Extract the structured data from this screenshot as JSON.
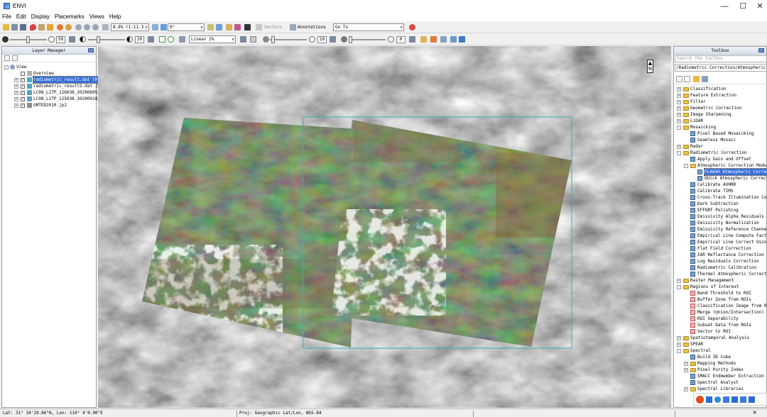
{
  "window": {
    "title": "ENVI",
    "minimize": "—",
    "maximize": "☐",
    "close": "✕"
  },
  "menu": [
    "File",
    "Edit",
    "Display",
    "Placemarks",
    "Views",
    "Help"
  ],
  "toolbar1": {
    "zoom_value": "8.8% (1:11.3",
    "rotation_value": "0°",
    "vectors_label": "Vectors",
    "annotations_label": "Annotations",
    "goto_value": "Go To"
  },
  "toolbar2": {
    "brightness_value": "50",
    "contrast_value": "20",
    "stretch_value": "Linear 2%",
    "sharpen_value": "10",
    "transparency_value": "0"
  },
  "layer_manager": {
    "title": "Layer Manager",
    "root": "View",
    "items": [
      {
        "label": "Overview",
        "checked": false,
        "selected": false
      },
      {
        "label": "radiometric_result.dat [R",
        "checked": true,
        "selected": true
      },
      {
        "label": "radiometric_result2.dat [R",
        "checked": true,
        "selected": false
      },
      {
        "label": "LC08_L1TP_126038_20200605_",
        "checked": true,
        "selected": false
      },
      {
        "label": "LC08_L1TP_125038_20200918_",
        "checked": true,
        "selected": false
      },
      {
        "label": "GMTED2010.jp2",
        "checked": true,
        "selected": false
      }
    ]
  },
  "map": {
    "north_label": "N",
    "north_icon": "north-arrow-icon"
  },
  "toolbox": {
    "title": "Toolbox",
    "search_placeholder": "Search the toolbox",
    "path": "/Radiometric Correction/Atmospheric Co",
    "items": [
      {
        "label": "Classification",
        "level": 0,
        "kind": "folder",
        "exp": "+"
      },
      {
        "label": "Feature Extraction",
        "level": 0,
        "kind": "folder",
        "exp": "+"
      },
      {
        "label": "Filter",
        "level": 0,
        "kind": "folder",
        "exp": "+"
      },
      {
        "label": "Geometric Correction",
        "level": 0,
        "kind": "folder",
        "exp": "+"
      },
      {
        "label": "Image Sharpening",
        "level": 0,
        "kind": "folder",
        "exp": "+"
      },
      {
        "label": "LiDAR",
        "level": 0,
        "kind": "folder",
        "exp": "+"
      },
      {
        "label": "Mosaicking",
        "level": 0,
        "kind": "folder",
        "exp": "-"
      },
      {
        "label": "Pixel Based Mosaicking",
        "level": 1,
        "kind": "tool"
      },
      {
        "label": "Seamless Mosaic",
        "level": 1,
        "kind": "tool"
      },
      {
        "label": "Radar",
        "level": 0,
        "kind": "folder",
        "exp": "+"
      },
      {
        "label": "Radiometric Correction",
        "level": 0,
        "kind": "folder",
        "exp": "-"
      },
      {
        "label": "Apply Gain and Offset",
        "level": 1,
        "kind": "tool"
      },
      {
        "label": "Atmospheric Correction Modul",
        "level": 1,
        "kind": "folder",
        "exp": "-"
      },
      {
        "label": "FLAASH Atmospheric Correc",
        "level": 2,
        "kind": "tool",
        "selected": true
      },
      {
        "label": "QUick Atmospheric Correct",
        "level": 2,
        "kind": "tool"
      },
      {
        "label": "Calibrate AVHRR",
        "level": 1,
        "kind": "tool"
      },
      {
        "label": "Calibrate TIMS",
        "level": 1,
        "kind": "tool"
      },
      {
        "label": "Cross-Track Illumination Cor",
        "level": 1,
        "kind": "tool"
      },
      {
        "label": "Dark Subtraction",
        "level": 1,
        "kind": "tool"
      },
      {
        "label": "EFFORT Polishing",
        "level": 1,
        "kind": "tool"
      },
      {
        "label": "Emissivity Alpha Residuals",
        "level": 1,
        "kind": "tool"
      },
      {
        "label": "Emissivity Normalization",
        "level": 1,
        "kind": "tool"
      },
      {
        "label": "Emissivity Reference Channel",
        "level": 1,
        "kind": "tool"
      },
      {
        "label": "Empirical Line Compute Facto",
        "level": 1,
        "kind": "tool"
      },
      {
        "label": "Empirical Line Correct Using",
        "level": 1,
        "kind": "tool"
      },
      {
        "label": "Flat Field Correction",
        "level": 1,
        "kind": "tool"
      },
      {
        "label": "IAR Reflectance Correction",
        "level": 1,
        "kind": "tool"
      },
      {
        "label": "Log Residuals Correction",
        "level": 1,
        "kind": "tool"
      },
      {
        "label": "Radiometric Calibration",
        "level": 1,
        "kind": "tool"
      },
      {
        "label": "Thermal Atmospheric Correcti",
        "level": 1,
        "kind": "tool"
      },
      {
        "label": "Raster Management",
        "level": 0,
        "kind": "folder",
        "exp": "+"
      },
      {
        "label": "Regions of Interest",
        "level": 0,
        "kind": "folder",
        "exp": "-"
      },
      {
        "label": "Band Threshold to ROI",
        "level": 1,
        "kind": "roi"
      },
      {
        "label": "Buffer Zone from ROIs",
        "level": 1,
        "kind": "roi"
      },
      {
        "label": "Classification Image from R",
        "level": 1,
        "kind": "roi"
      },
      {
        "label": "Merge (Union/Intersection)",
        "level": 1,
        "kind": "roi"
      },
      {
        "label": "ROI Separability",
        "level": 1,
        "kind": "roi"
      },
      {
        "label": "Subset Data from ROIs",
        "level": 1,
        "kind": "roi"
      },
      {
        "label": "Vector to ROI",
        "level": 1,
        "kind": "roi"
      },
      {
        "label": "Spatiotemporal Analysis",
        "level": 0,
        "kind": "folder",
        "exp": "+"
      },
      {
        "label": "SPEAR",
        "level": 0,
        "kind": "folder",
        "exp": "+"
      },
      {
        "label": "Spectral",
        "level": 0,
        "kind": "folder",
        "exp": "-"
      },
      {
        "label": "Build 3D Cube",
        "level": 1,
        "kind": "tool"
      },
      {
        "label": "Mapping Methods",
        "level": 1,
        "kind": "folder",
        "exp": "+"
      },
      {
        "label": "Pixel Purity Index",
        "level": 1,
        "kind": "folder",
        "exp": "+"
      },
      {
        "label": "SMACC Endmember Extraction",
        "level": 1,
        "kind": "tool"
      },
      {
        "label": "Spectral Analyst",
        "level": 1,
        "kind": "tool"
      },
      {
        "label": "Spectral Libraries",
        "level": 1,
        "kind": "folder",
        "exp": "+"
      }
    ]
  },
  "status": {
    "coords": "Lat: 31° 34'29.86\"N, Lon: 110° 4'0.90\"E",
    "proj": "Proj: Geographic Lat/Lon, WGS-84"
  },
  "colors": {
    "selection": "#3a6fd8",
    "roi_box": "#2fb4b4",
    "panel_border": "#a0a0a0"
  }
}
